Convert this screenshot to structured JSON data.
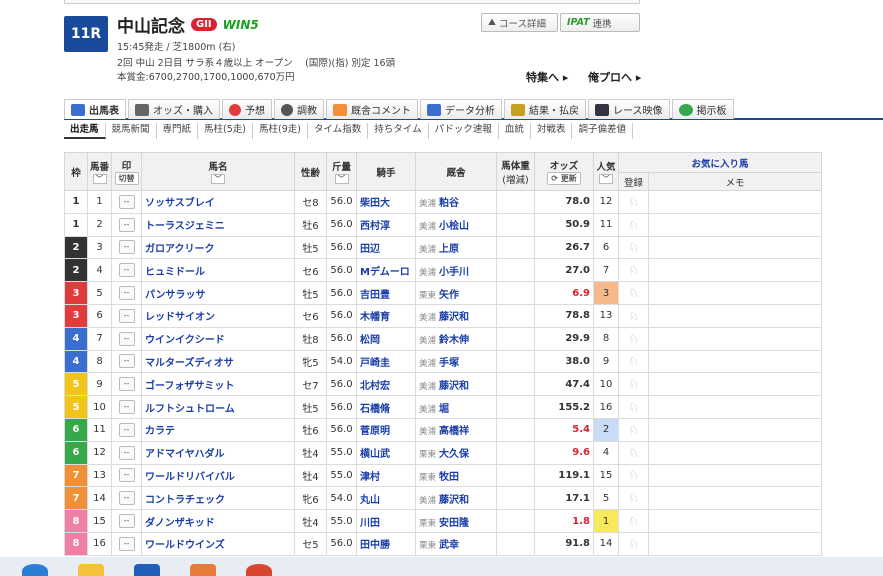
{
  "race": {
    "number": "11R",
    "name": "中山記念",
    "grade": "GII",
    "win5": "WIN5",
    "line1": "15:45発走 / 芝1800m (右)",
    "line2": "2回 中山 2日目 サラ系４歳以上 オープン　 (国際)(指) 別定 16頭",
    "line3": "本賞金:6700,2700,1700,1000,670万円"
  },
  "buttons": {
    "course": "コース詳細",
    "ipat": "IPAT",
    "ipat_suffix": "連携",
    "feature": "特集へ ▸",
    "pro": "俺プロへ ▸"
  },
  "tabs": [
    "出馬表",
    "オッズ・購入",
    "予想",
    "調教",
    "厩舎コメント",
    "データ分析",
    "結果・払戻",
    "レース映像",
    "掲示板"
  ],
  "subtabs": [
    "出走馬",
    "競馬新聞",
    "専門紙",
    "馬柱(5走)",
    "馬柱(9走)",
    "タイム指数",
    "持ちタイム",
    "パドック速報",
    "血統",
    "対戦表",
    "調子偏差値"
  ],
  "headers": {
    "waku": "枠",
    "umaban": "馬番",
    "mark": "印",
    "mark_sub": "切替",
    "horse": "馬名",
    "sexage": "性齢",
    "weight": "斤量",
    "jockey": "騎手",
    "trainer": "厩舎",
    "body": "馬体重",
    "body_sub": "(増減)",
    "odds": "オッズ",
    "odds_sub": "更新",
    "pop": "人気",
    "fav": "お気に入り馬",
    "reg": "登録",
    "memo": "メモ"
  },
  "rows": [
    {
      "waku": "1",
      "umaban": "1",
      "mark": "--",
      "horse": "ソッサスブレイ",
      "sexage": "セ8",
      "weight": "56.0",
      "jockey": "柴田大",
      "region": "美浦",
      "trainer": "粕谷",
      "odds": "78.0",
      "pop": "12"
    },
    {
      "waku": "1",
      "umaban": "2",
      "mark": "--",
      "horse": "トーラスジェミニ",
      "sexage": "牡6",
      "weight": "56.0",
      "jockey": "西村淳",
      "region": "美浦",
      "trainer": "小桧山",
      "odds": "50.9",
      "pop": "11"
    },
    {
      "waku": "2",
      "umaban": "3",
      "mark": "--",
      "horse": "ガロアクリーク",
      "sexage": "牡5",
      "weight": "56.0",
      "jockey": "田辺",
      "region": "美浦",
      "trainer": "上原",
      "odds": "26.7",
      "pop": "6"
    },
    {
      "waku": "2",
      "umaban": "4",
      "mark": "--",
      "horse": "ヒュミドール",
      "sexage": "セ6",
      "weight": "56.0",
      "jockey": "Mデムーロ",
      "region": "美浦",
      "trainer": "小手川",
      "odds": "27.0",
      "pop": "7"
    },
    {
      "waku": "3",
      "umaban": "5",
      "mark": "--",
      "horse": "パンサラッサ",
      "sexage": "牡5",
      "weight": "56.0",
      "jockey": "吉田豊",
      "region": "栗東",
      "trainer": "矢作",
      "odds": "6.9",
      "pop": "3"
    },
    {
      "waku": "3",
      "umaban": "6",
      "mark": "--",
      "horse": "レッドサイオン",
      "sexage": "セ6",
      "weight": "56.0",
      "jockey": "木幡育",
      "region": "美浦",
      "trainer": "藤沢和",
      "odds": "78.8",
      "pop": "13"
    },
    {
      "waku": "4",
      "umaban": "7",
      "mark": "--",
      "horse": "ウインイクシード",
      "sexage": "牡8",
      "weight": "56.0",
      "jockey": "松岡",
      "region": "美浦",
      "trainer": "鈴木伸",
      "odds": "29.9",
      "pop": "8"
    },
    {
      "waku": "4",
      "umaban": "8",
      "mark": "--",
      "horse": "マルターズディオサ",
      "sexage": "牝5",
      "weight": "54.0",
      "jockey": "戸崎圭",
      "region": "美浦",
      "trainer": "手塚",
      "odds": "38.0",
      "pop": "9"
    },
    {
      "waku": "5",
      "umaban": "9",
      "mark": "--",
      "horse": "ゴーフォザサミット",
      "sexage": "セ7",
      "weight": "56.0",
      "jockey": "北村宏",
      "region": "美浦",
      "trainer": "藤沢和",
      "odds": "47.4",
      "pop": "10"
    },
    {
      "waku": "5",
      "umaban": "10",
      "mark": "--",
      "horse": "ルフトシュトローム",
      "sexage": "牡5",
      "weight": "56.0",
      "jockey": "石橋脩",
      "region": "美浦",
      "trainer": "堀",
      "odds": "155.2",
      "pop": "16"
    },
    {
      "waku": "6",
      "umaban": "11",
      "mark": "--",
      "horse": "カラテ",
      "sexage": "牡6",
      "weight": "56.0",
      "jockey": "菅原明",
      "region": "美浦",
      "trainer": "高橋祥",
      "odds": "5.4",
      "pop": "2"
    },
    {
      "waku": "6",
      "umaban": "12",
      "mark": "--",
      "horse": "アドマイヤハダル",
      "sexage": "牡4",
      "weight": "55.0",
      "jockey": "横山武",
      "region": "栗東",
      "trainer": "大久保",
      "odds": "9.6",
      "pop": "4"
    },
    {
      "waku": "7",
      "umaban": "13",
      "mark": "--",
      "horse": "ワールドリバイバル",
      "sexage": "牡4",
      "weight": "55.0",
      "jockey": "津村",
      "region": "栗東",
      "trainer": "牧田",
      "odds": "119.1",
      "pop": "15"
    },
    {
      "waku": "7",
      "umaban": "14",
      "mark": "--",
      "horse": "コントラチェック",
      "sexage": "牝6",
      "weight": "54.0",
      "jockey": "丸山",
      "region": "美浦",
      "trainer": "藤沢和",
      "odds": "17.1",
      "pop": "5"
    },
    {
      "waku": "8",
      "umaban": "15",
      "mark": "--",
      "horse": "ダノンザキッド",
      "sexage": "牡4",
      "weight": "55.0",
      "jockey": "川田",
      "region": "栗東",
      "trainer": "安田隆",
      "odds": "1.8",
      "pop": "1"
    },
    {
      "waku": "8",
      "umaban": "16",
      "mark": "--",
      "horse": "ワールドウインズ",
      "sexage": "セ5",
      "weight": "56.0",
      "jockey": "田中勝",
      "region": "栗東",
      "trainer": "武幸",
      "odds": "91.8",
      "pop": "14"
    }
  ],
  "colors": {
    "brand": "#1a4a9c",
    "grade": "#d9232e",
    "link": "#1a3ea8"
  },
  "taskbar_icons": [
    "windows-start-icon",
    "file-explorer-icon",
    "mail-icon",
    "app-icon",
    "chrome-icon"
  ]
}
